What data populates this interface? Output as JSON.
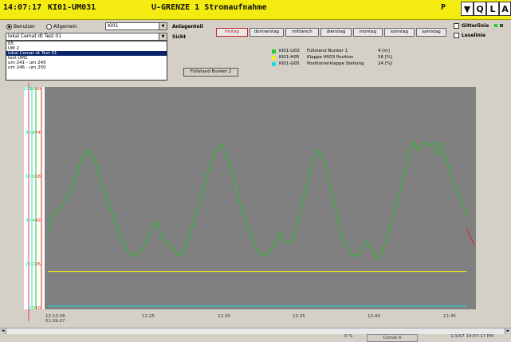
{
  "titlebar": {
    "time": "14:07:17",
    "station": "KI01-UM031",
    "title": "U-GRENZE 1 Stromaufnahme",
    "mode": "P",
    "buttons": [
      "Q",
      "L",
      "A"
    ],
    "arrow_icon": "down-arrow-icon"
  },
  "user": {
    "benutzer_label": "Benutzer",
    "allgemein_label": "Allgemein",
    "selected": "benutzer",
    "combo_small_value": "KI01",
    "combo_value": "lokal Cemat dt Test 01",
    "list_items": [
      "05",
      "UM 2",
      "lokal Cemat dt Test 01",
      "test UM1",
      "um 241 - um 245",
      "um 246 - um 250"
    ],
    "selected_index": 2
  },
  "anlagenteil_label": "Anlagenteil",
  "sicht_label": "Sicht",
  "days": [
    "freitag",
    "donnerstag",
    "mittwoch",
    "dienstag",
    "montag",
    "sonntag",
    "samstag"
  ],
  "active_day": "freitag",
  "options": {
    "gitterlinie_label": "Gitterlinie",
    "lesslinie_label": "Leselinie"
  },
  "fuellstand_button": "Füllstand Bunker 2",
  "legend": [
    {
      "tag": "KI01-LI02",
      "desc": "Füllstand Bunker 1",
      "value": "4 [m]",
      "color": "#22cc22"
    },
    {
      "tag": "KI01-H05",
      "desc": "Klappe H003 Position",
      "value": "16 [%]",
      "color": "#eeee22"
    },
    {
      "tag": "KI01-G05",
      "desc": "Positionierklappe Stellung",
      "value": "24 [%]",
      "color": "#22dddd"
    }
  ],
  "chart_data": {
    "type": "line",
    "x_ticks": [
      "12:10:36\n01.09.07",
      "12:25",
      "12:30",
      "12:35",
      "12:40",
      "12:45"
    ],
    "axes": [
      {
        "color": "#22dddd",
        "ticks": [
          "100",
          "80",
          "60",
          "40",
          "20",
          "0"
        ]
      },
      {
        "color": "#22cc22",
        "ticks": [
          "10",
          "8",
          "6",
          "4",
          "2",
          "0"
        ]
      },
      {
        "color": "#dd2222",
        "ticks": [
          "90",
          "74",
          "58",
          "42",
          "26",
          "10"
        ]
      }
    ],
    "series": [
      {
        "name": "KI01-LI02",
        "color": "#22cc22",
        "values": [
          [
            0,
            0.33
          ],
          [
            0.01,
            0.42
          ],
          [
            0.03,
            0.45
          ],
          [
            0.05,
            0.52
          ],
          [
            0.07,
            0.62
          ],
          [
            0.085,
            0.7
          ],
          [
            0.1,
            0.72
          ],
          [
            0.115,
            0.66
          ],
          [
            0.13,
            0.55
          ],
          [
            0.15,
            0.45
          ],
          [
            0.165,
            0.37
          ],
          [
            0.18,
            0.3
          ],
          [
            0.195,
            0.24
          ],
          [
            0.21,
            0.23
          ],
          [
            0.225,
            0.26
          ],
          [
            0.24,
            0.32
          ],
          [
            0.255,
            0.39
          ],
          [
            0.265,
            0.37
          ],
          [
            0.275,
            0.31
          ],
          [
            0.29,
            0.29
          ],
          [
            0.305,
            0.25
          ],
          [
            0.315,
            0.23
          ],
          [
            0.33,
            0.28
          ],
          [
            0.35,
            0.4
          ],
          [
            0.37,
            0.53
          ],
          [
            0.385,
            0.63
          ],
          [
            0.4,
            0.72
          ],
          [
            0.415,
            0.75
          ],
          [
            0.43,
            0.68
          ],
          [
            0.445,
            0.58
          ],
          [
            0.46,
            0.47
          ],
          [
            0.48,
            0.36
          ],
          [
            0.5,
            0.26
          ],
          [
            0.515,
            0.23
          ],
          [
            0.53,
            0.25
          ],
          [
            0.545,
            0.3
          ],
          [
            0.555,
            0.34
          ],
          [
            0.565,
            0.3
          ],
          [
            0.575,
            0.29
          ],
          [
            0.59,
            0.32
          ],
          [
            0.6,
            0.42
          ],
          [
            0.615,
            0.53
          ],
          [
            0.63,
            0.64
          ],
          [
            0.645,
            0.72
          ],
          [
            0.66,
            0.68
          ],
          [
            0.675,
            0.56
          ],
          [
            0.69,
            0.43
          ],
          [
            0.7,
            0.33
          ],
          [
            0.715,
            0.27
          ],
          [
            0.73,
            0.23
          ],
          [
            0.745,
            0.24
          ],
          [
            0.76,
            0.3
          ],
          [
            0.77,
            0.28
          ],
          [
            0.78,
            0.24
          ],
          [
            0.79,
            0.22
          ],
          [
            0.8,
            0.26
          ],
          [
            0.82,
            0.38
          ],
          [
            0.84,
            0.52
          ],
          [
            0.855,
            0.64
          ],
          [
            0.865,
            0.72
          ],
          [
            0.875,
            0.76
          ],
          [
            0.885,
            0.72
          ],
          [
            0.9,
            0.76
          ],
          [
            0.91,
            0.74
          ],
          [
            0.92,
            0.76
          ],
          [
            0.93,
            0.7
          ],
          [
            0.94,
            0.76
          ],
          [
            0.95,
            0.69
          ],
          [
            0.965,
            0.6
          ],
          [
            0.98,
            0.52
          ],
          [
            0.99,
            0.48
          ],
          [
            1.0,
            0.42
          ]
        ]
      },
      {
        "name": "KI01-H05",
        "color": "#eeee22",
        "values": [
          [
            0,
            0.16
          ],
          [
            1,
            0.16
          ]
        ]
      },
      {
        "name": "KI01-G05",
        "color": "#22dddd",
        "values": [
          [
            0,
            0.0
          ],
          [
            1,
            0.0
          ]
        ]
      }
    ],
    "red_tail": {
      "color": "#dd2222",
      "values": [
        [
          1.0,
          0.36
        ],
        [
          1.0,
          0.36
        ],
        [
          1.02,
          0.28
        ]
      ]
    }
  },
  "statusbar": {
    "percent": "0 %",
    "app": "Cemat 6",
    "datetime": "1/1/07 14:07:17 PM"
  }
}
